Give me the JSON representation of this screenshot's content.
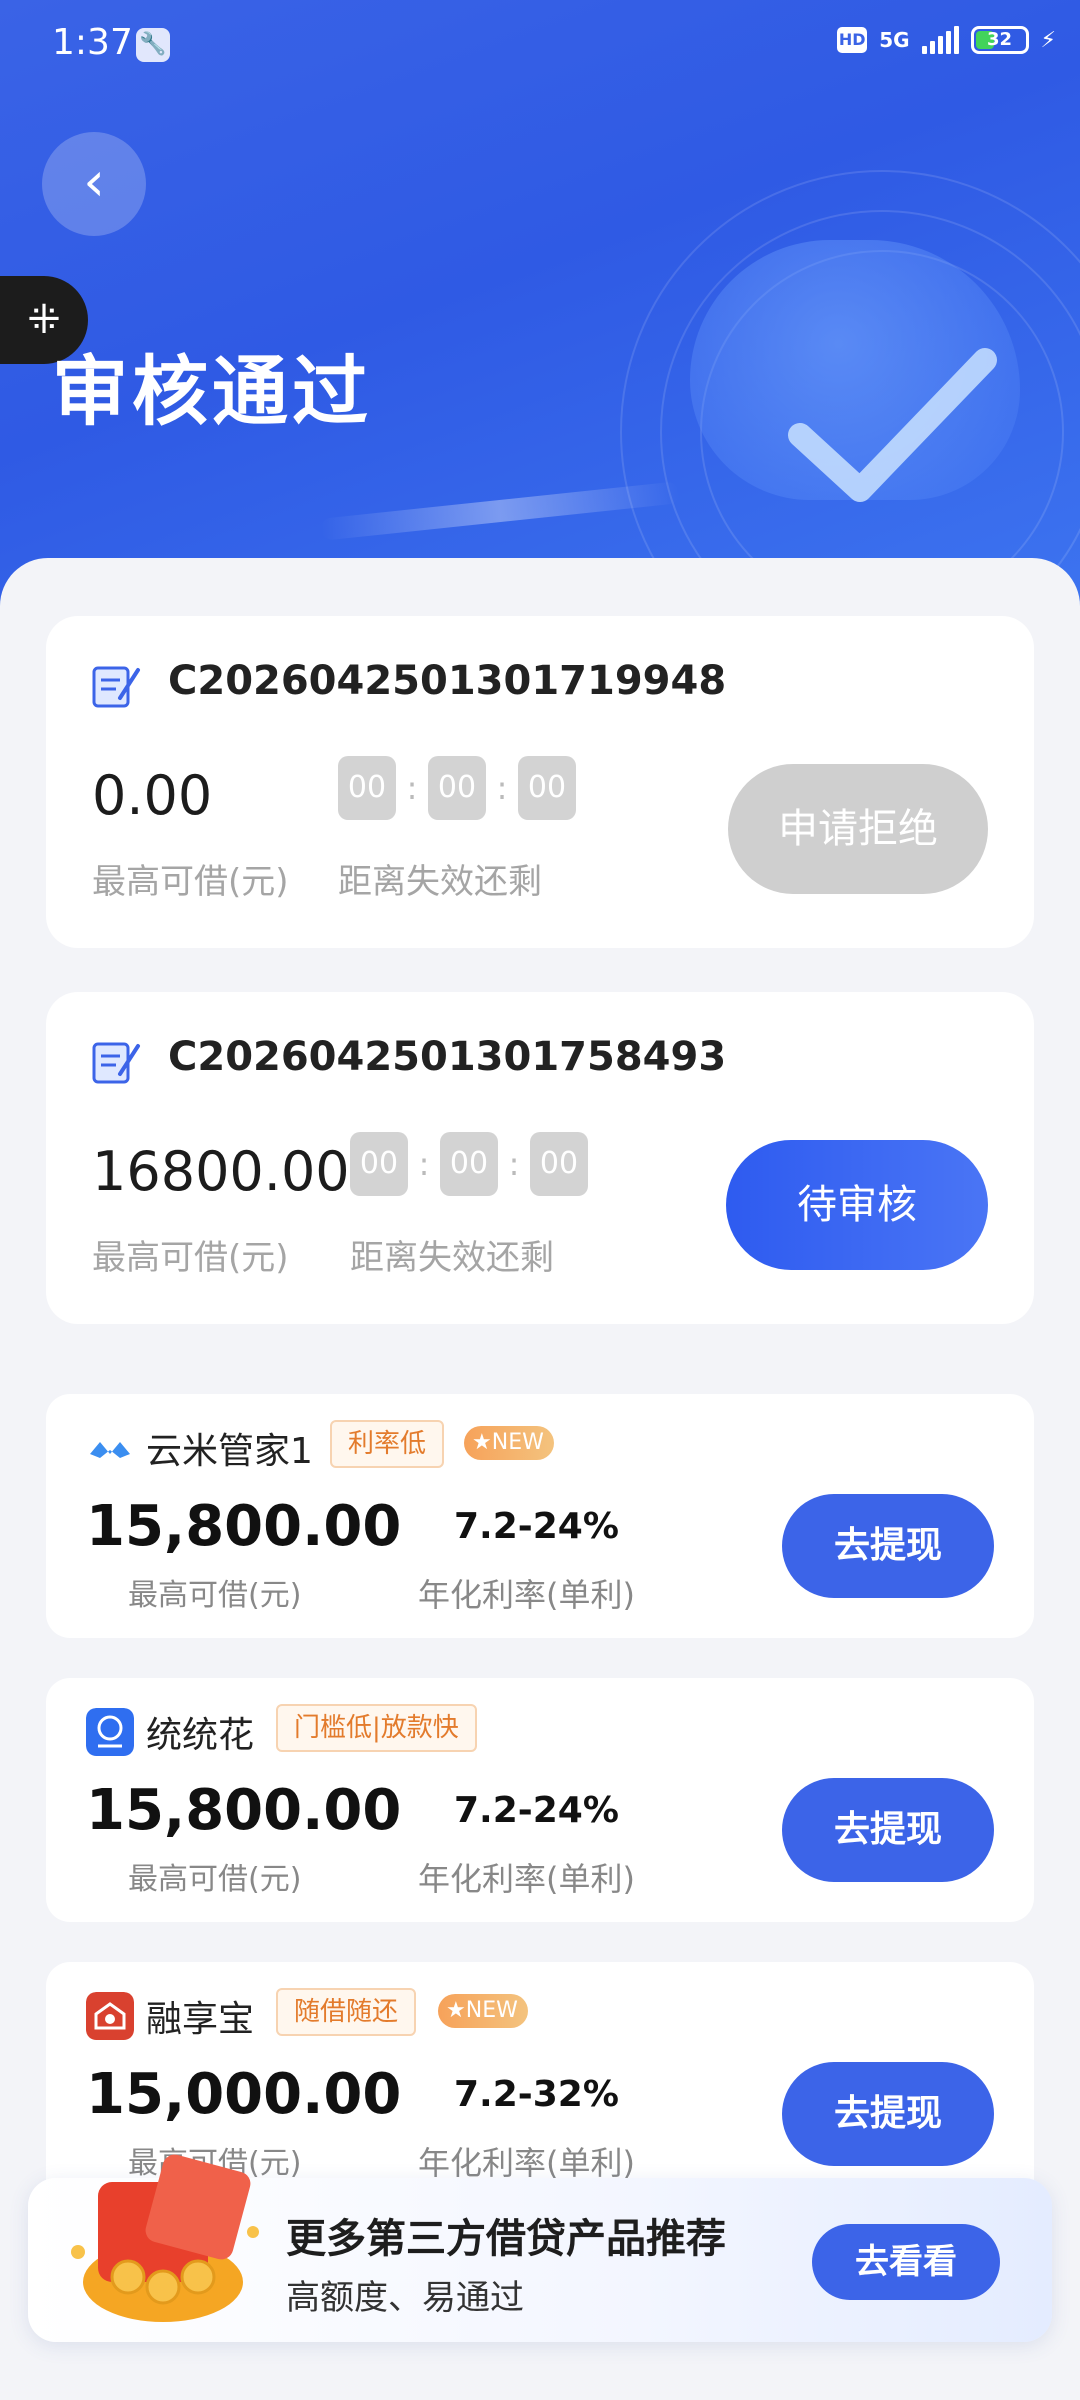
{
  "status_bar": {
    "time": "1:37",
    "network": "5G",
    "hd": "HD",
    "battery": "32"
  },
  "header": {
    "title": "审核通过"
  },
  "orders": [
    {
      "id": "C202604250130171994 8",
      "amount": "0.00",
      "amount_label": "最高可借(元)",
      "timer": [
        "00",
        "00",
        "00"
      ],
      "timer_label": "距离失效还剩",
      "button_label": "申请拒绝",
      "button_state": "disabled"
    },
    {
      "id": "C2026042501301758493",
      "amount": "16800.00",
      "amount_label": "最高可借(元)",
      "timer": [
        "00",
        "00",
        "00"
      ],
      "timer_label": "距离失效还剩",
      "button_label": "待审核",
      "button_state": "active"
    }
  ],
  "products": [
    {
      "name": "云米管家1",
      "logo_icon": "yunmi-logo-icon",
      "tag": "利率低",
      "new_badge": "NEW",
      "amount": "15,800.00",
      "amount_label": "最高可借(元)",
      "rate": "7.2-24%",
      "rate_label": "年化利率(单利)",
      "button_label": "去提现"
    },
    {
      "name": "统统花",
      "logo_icon": "tongtonghua-logo-icon",
      "tag": "门槛低|放款快",
      "new_badge": "",
      "amount": "15,800.00",
      "amount_label": "最高可借(元)",
      "rate": "7.2-24%",
      "rate_label": "年化利率(单利)",
      "button_label": "去提现"
    },
    {
      "name": "融享宝",
      "logo_icon": "rongxiangbao-logo-icon",
      "tag": "随借随还",
      "new_badge": "NEW",
      "amount": "15,000.00",
      "amount_label": "最高可借(元)",
      "rate": "7.2-32%",
      "rate_label": "年化利率(单利)",
      "button_label": "去提现"
    }
  ],
  "banner": {
    "title": "更多第三方借贷产品推荐",
    "subtitle": "高额度、易通过",
    "button_label": "去看看"
  },
  "colors": {
    "primary_blue": "#3c64e8",
    "disabled_grey": "#cfcfcf",
    "tag_orange": "#e37b2c"
  }
}
